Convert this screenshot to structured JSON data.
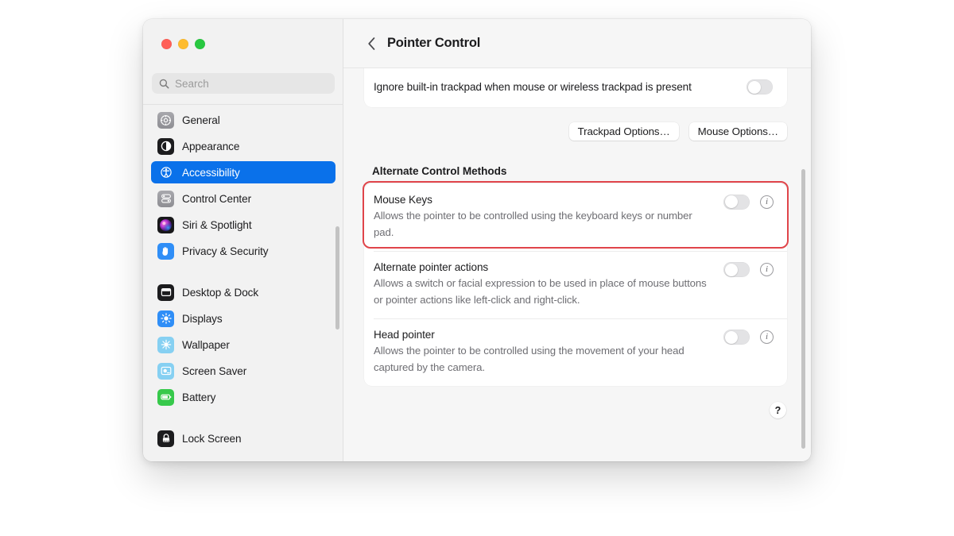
{
  "window": {
    "traffic_lights": [
      {
        "name": "close",
        "color": "#ff5f57"
      },
      {
        "name": "minimize",
        "color": "#febc2e"
      },
      {
        "name": "zoom",
        "color": "#28c840"
      }
    ]
  },
  "sidebar": {
    "search": {
      "value": "",
      "placeholder": "Search"
    },
    "groups": [
      {
        "items": [
          {
            "label": "General",
            "icon": "gear-icon",
            "selected": false
          },
          {
            "label": "Appearance",
            "icon": "appearance-icon",
            "selected": false
          },
          {
            "label": "Accessibility",
            "icon": "accessibility-icon",
            "selected": true
          },
          {
            "label": "Control Center",
            "icon": "control-center-icon",
            "selected": false
          },
          {
            "label": "Siri & Spotlight",
            "icon": "siri-icon",
            "selected": false
          },
          {
            "label": "Privacy & Security",
            "icon": "privacy-hand-icon",
            "selected": false
          }
        ]
      },
      {
        "items": [
          {
            "label": "Desktop & Dock",
            "icon": "desktop-dock-icon",
            "selected": false
          },
          {
            "label": "Displays",
            "icon": "displays-icon",
            "selected": false
          },
          {
            "label": "Wallpaper",
            "icon": "wallpaper-icon",
            "selected": false
          },
          {
            "label": "Screen Saver",
            "icon": "screen-saver-icon",
            "selected": false
          },
          {
            "label": "Battery",
            "icon": "battery-icon",
            "selected": false
          }
        ]
      },
      {
        "items": [
          {
            "label": "Lock Screen",
            "icon": "lock-screen-icon",
            "selected": false
          }
        ]
      }
    ]
  },
  "detail": {
    "back_label": "‹",
    "title": "Pointer Control",
    "top_card": {
      "text": "Ignore built-in trackpad when mouse or wireless trackpad is present",
      "toggle_on": false
    },
    "buttons": {
      "trackpad_options": "Trackpad Options…",
      "mouse_options": "Mouse Options…"
    },
    "section_title": "Alternate Control Methods",
    "settings": [
      {
        "title": "Mouse Keys",
        "description": "Allows the pointer to be controlled using the keyboard keys or number pad.",
        "toggle_on": false,
        "info": "i",
        "highlighted": true
      },
      {
        "title": "Alternate pointer actions",
        "description": "Allows a switch or facial expression to be used in place of mouse buttons or pointer actions like left-click and right-click.",
        "toggle_on": false,
        "info": "i",
        "highlighted": false
      },
      {
        "title": "Head pointer",
        "description": "Allows the pointer to be controlled using the movement of your head captured by the camera.",
        "toggle_on": false,
        "info": "i",
        "highlighted": false
      }
    ],
    "help_label": "?"
  },
  "colors": {
    "accent": "#0a71ea",
    "highlight_outline": "#e0454a",
    "sidebar_bg": "#f2f2f2",
    "pane_bg": "#f6f6f6",
    "card_bg": "#ffffff"
  }
}
